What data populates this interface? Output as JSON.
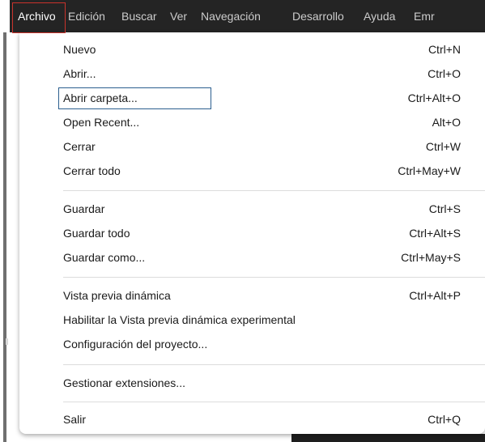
{
  "menubar": {
    "items": [
      {
        "label": "Archivo"
      },
      {
        "label": "Edición"
      },
      {
        "label": "Buscar"
      },
      {
        "label": "Ver"
      },
      {
        "label": "Navegación"
      },
      {
        "label": "Desarrollo"
      },
      {
        "label": "Ayuda"
      },
      {
        "label": "Emr"
      }
    ]
  },
  "menu": {
    "items": [
      {
        "label": "Nuevo",
        "shortcut": "Ctrl+N"
      },
      {
        "label": "Abrir...",
        "shortcut": "Ctrl+O"
      },
      {
        "label": "Abrir carpeta...",
        "shortcut": "Ctrl+Alt+O"
      },
      {
        "label": "Open Recent...",
        "shortcut": "Alt+O"
      },
      {
        "label": "Cerrar",
        "shortcut": "Ctrl+W"
      },
      {
        "label": "Cerrar todo",
        "shortcut": "Ctrl+May+W"
      },
      {
        "label": "Guardar",
        "shortcut": "Ctrl+S"
      },
      {
        "label": "Guardar todo",
        "shortcut": "Ctrl+Alt+S"
      },
      {
        "label": "Guardar como...",
        "shortcut": "Ctrl+May+S"
      },
      {
        "label": "Vista previa dinámica",
        "shortcut": "Ctrl+Alt+P"
      },
      {
        "label": "Habilitar la Vista previa dinámica experimental",
        "shortcut": ""
      },
      {
        "label": "Configuración del proyecto...",
        "shortcut": ""
      },
      {
        "label": "Gestionar extensiones...",
        "shortcut": ""
      },
      {
        "label": "Salir",
        "shortcut": "Ctrl+Q"
      }
    ]
  },
  "colors": {
    "menubar_bg": "#242424",
    "menubar_text": "#cccccc",
    "active_frame": "#c9332c",
    "focus_outline": "#2b5f8f",
    "menu_bg": "#ffffff",
    "menu_text": "#1a1a1a"
  }
}
